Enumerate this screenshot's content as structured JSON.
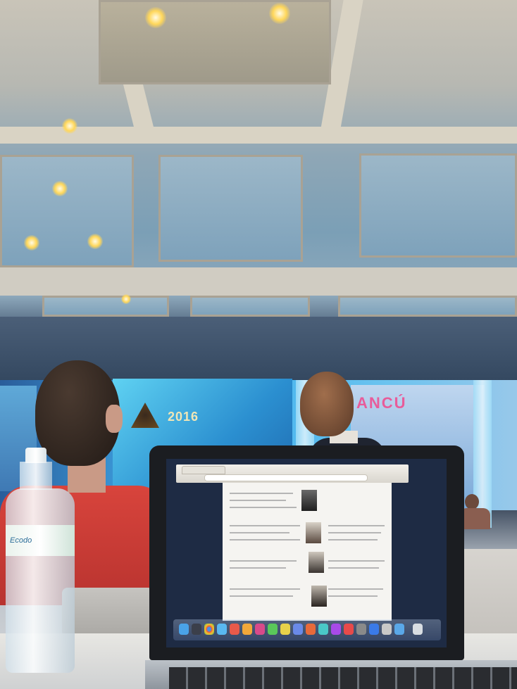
{
  "scene": {
    "stage_banner_text": "2016",
    "stage_right_banner_text": "ANCÚ",
    "bottle_label_text": "Ecodo",
    "colors": {
      "stage_blue": "#3fa6e6",
      "ceiling": "#8fa7b6",
      "shirt_red": "#d8443c",
      "laptop_black": "#1b1d21"
    }
  }
}
